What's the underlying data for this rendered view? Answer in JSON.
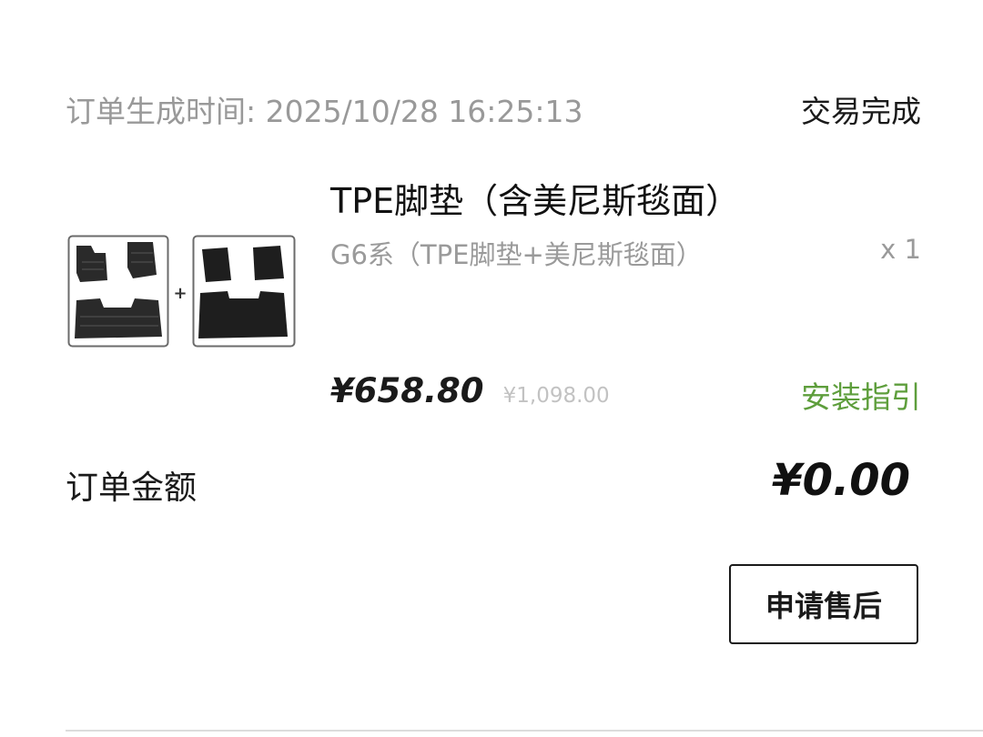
{
  "order": {
    "time_label": "订单生成时间:",
    "time_value": "2025/10/28 16:25:13",
    "status": "交易完成"
  },
  "product": {
    "image_icon": "car-floor-mat-set-icon",
    "image_plus": "+",
    "title": "TPE脚垫（含美尼斯毯面）",
    "variant": "G6系（TPE脚垫+美尼斯毯面）",
    "quantity": "x 1",
    "price_current": "¥658.80",
    "price_original": "¥1,098.00",
    "install_link": "安装指引"
  },
  "total": {
    "label": "订单金额",
    "value": "¥0.00"
  },
  "actions": {
    "aftersale_label": "申请售后"
  },
  "colors": {
    "accent_green": "#5e9e3c",
    "muted_gray": "#999999",
    "text_dark": "#1a1a1a"
  }
}
